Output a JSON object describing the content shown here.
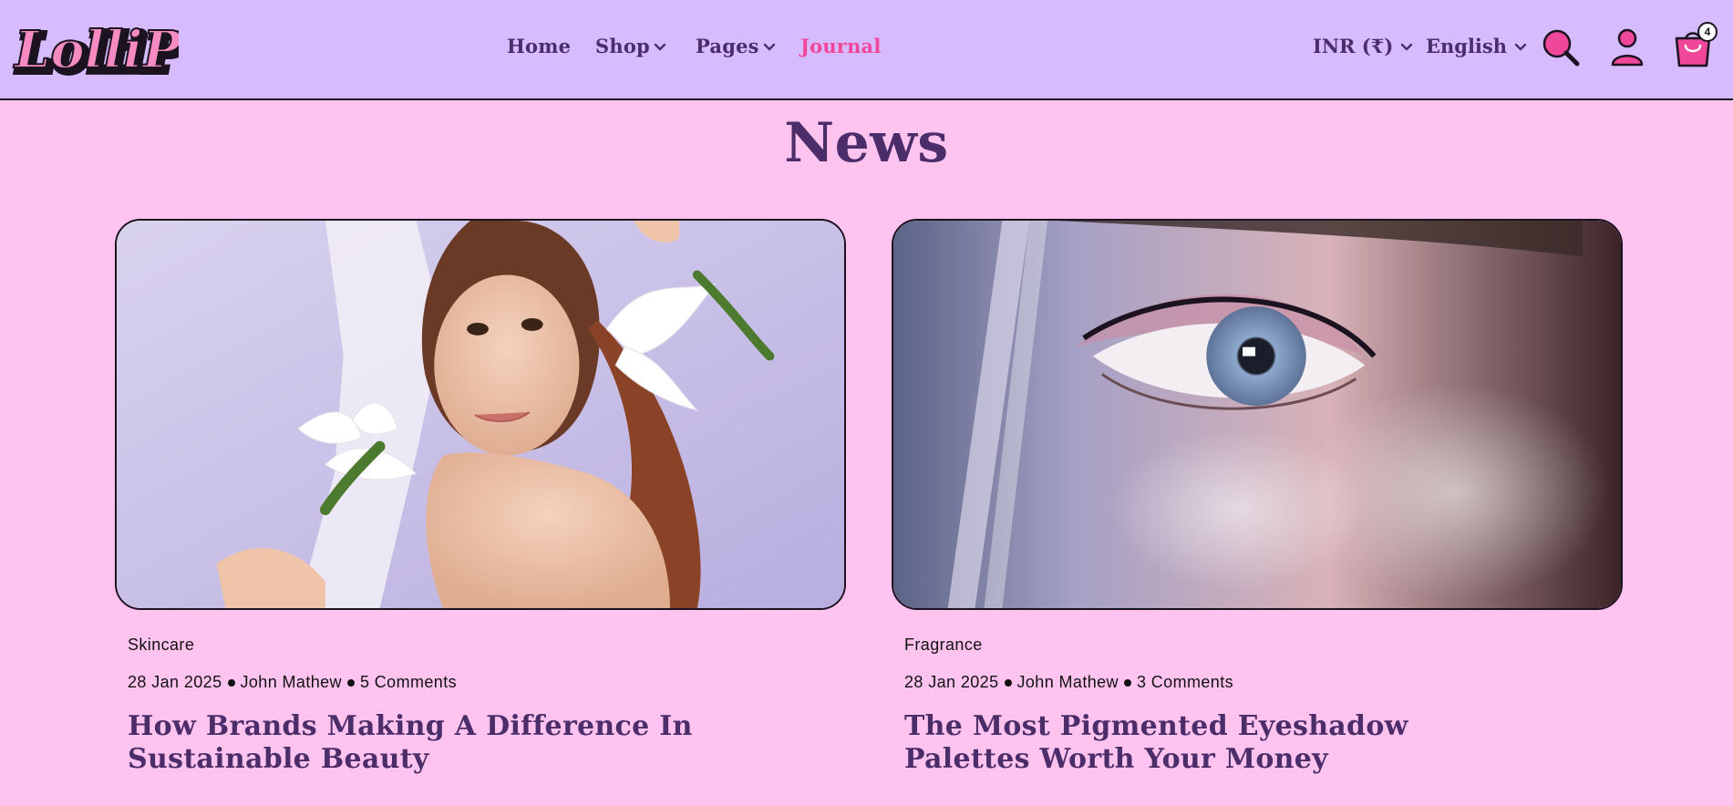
{
  "brand": {
    "logo_text": "LolliPop"
  },
  "nav": {
    "home": "Home",
    "shop": "Shop",
    "pages": "Pages",
    "journal": "Journal"
  },
  "header_utils": {
    "currency": "INR (₹)",
    "language": "English",
    "cart_count": "4"
  },
  "page": {
    "title": "News"
  },
  "posts": [
    {
      "category": "Skincare",
      "date": "28 Jan 2025",
      "author": "John Mathew",
      "comments": "5 Comments",
      "title": "How Brands Making A Difference In Sustainable Beauty",
      "excerpt": ""
    },
    {
      "category": "Fragrance",
      "date": "28 Jan 2025",
      "author": "John Mathew",
      "comments": "3 Comments",
      "title": "The Most Pigmented Eyeshadow Palettes Worth Your Money",
      "excerpt": ""
    }
  ],
  "colors": {
    "header_bg": "#d6bcff",
    "page_bg": "#ffc3ef",
    "heading": "#4b2d6a",
    "accent": "#f0479a"
  }
}
